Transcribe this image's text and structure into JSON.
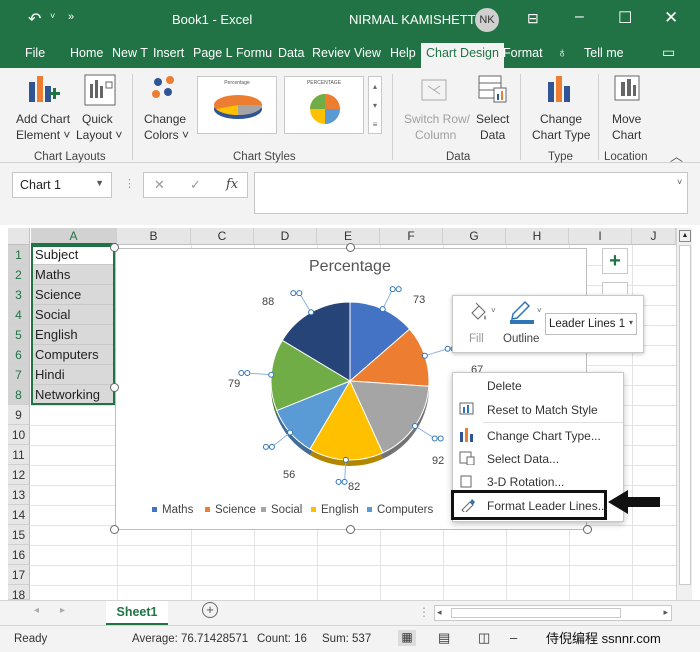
{
  "title_bar": {
    "doc_title": "Book1 - Excel",
    "user_name": "NIRMAL KAMISHETTY",
    "user_initials": "NK"
  },
  "tabs": [
    "File",
    "Home",
    "New T",
    "Insert",
    "Page L",
    "Formu",
    "Data",
    "Reviev",
    "View",
    "Help",
    "Chart Design",
    "Format"
  ],
  "tell_me": "Tell me",
  "ribbon": {
    "add_chart_element": [
      "Add Chart",
      "Element ˅"
    ],
    "quick_layout": [
      "Quick",
      "Layout ˅"
    ],
    "change_colors": [
      "Change",
      "Colors ˅"
    ],
    "switch_row_col": [
      "Switch Row/",
      "Column"
    ],
    "select_data": [
      "Select",
      "Data"
    ],
    "change_chart_type": [
      "Change",
      "Chart Type"
    ],
    "move_chart": [
      "Move",
      "Chart"
    ],
    "groups": {
      "chart_layouts": "Chart Layouts",
      "chart_styles": "Chart Styles",
      "data": "Data",
      "type": "Type",
      "location": "Location"
    },
    "style_thumb_1_title": "Percentage",
    "style_thumb_2_title": "PERCENTAGE"
  },
  "formula_bar": {
    "name_box": "Chart 1",
    "fx": "fx",
    "cancel": "✕",
    "enter": "✓"
  },
  "columns": [
    "A",
    "B",
    "C",
    "D",
    "E",
    "F",
    "G",
    "H",
    "I",
    "J"
  ],
  "rows": [
    "1",
    "2",
    "3",
    "4",
    "5",
    "6",
    "7",
    "8",
    "9",
    "10",
    "11",
    "12",
    "13",
    "14",
    "15",
    "16",
    "17",
    "18"
  ],
  "cells_a": [
    "Subject",
    "Maths",
    "Science",
    "Social",
    "English",
    "Computers",
    "Hindi",
    "Networking"
  ],
  "chart_data": {
    "type": "pie",
    "title": "Percentage",
    "categories": [
      "Maths",
      "Science",
      "Social",
      "English",
      "Computers",
      "Hindi",
      "Networking"
    ],
    "values": [
      73,
      67,
      92,
      82,
      56,
      79,
      88
    ],
    "colors": [
      "#4472c4",
      "#ed7d31",
      "#a5a5a5",
      "#ffc000",
      "#5b9bd5",
      "#70ad47",
      "#264478"
    ],
    "legend_position": "bottom"
  },
  "chart_labels": {
    "maths": "73",
    "science": "67",
    "social": "92",
    "english": "82",
    "computers": "56",
    "hindi": "79",
    "networking": "88"
  },
  "mini_toolbar": {
    "fill": "Fill",
    "outline": "Outline",
    "dropdown": "Leader Lines 1"
  },
  "context_menu": [
    "Delete",
    "Reset to Match Style",
    "Change Chart Type...",
    "Select Data...",
    "3-D Rotation...",
    "Format Leader Lines..."
  ],
  "sheet": {
    "tab": "Sheet1",
    "add": "+"
  },
  "status": {
    "ready": "Ready",
    "average": "Average: 76.71428571",
    "count": "Count: 16",
    "sum": "Sum: 537",
    "watermark": "侍倪编程 ssnnr.com"
  }
}
